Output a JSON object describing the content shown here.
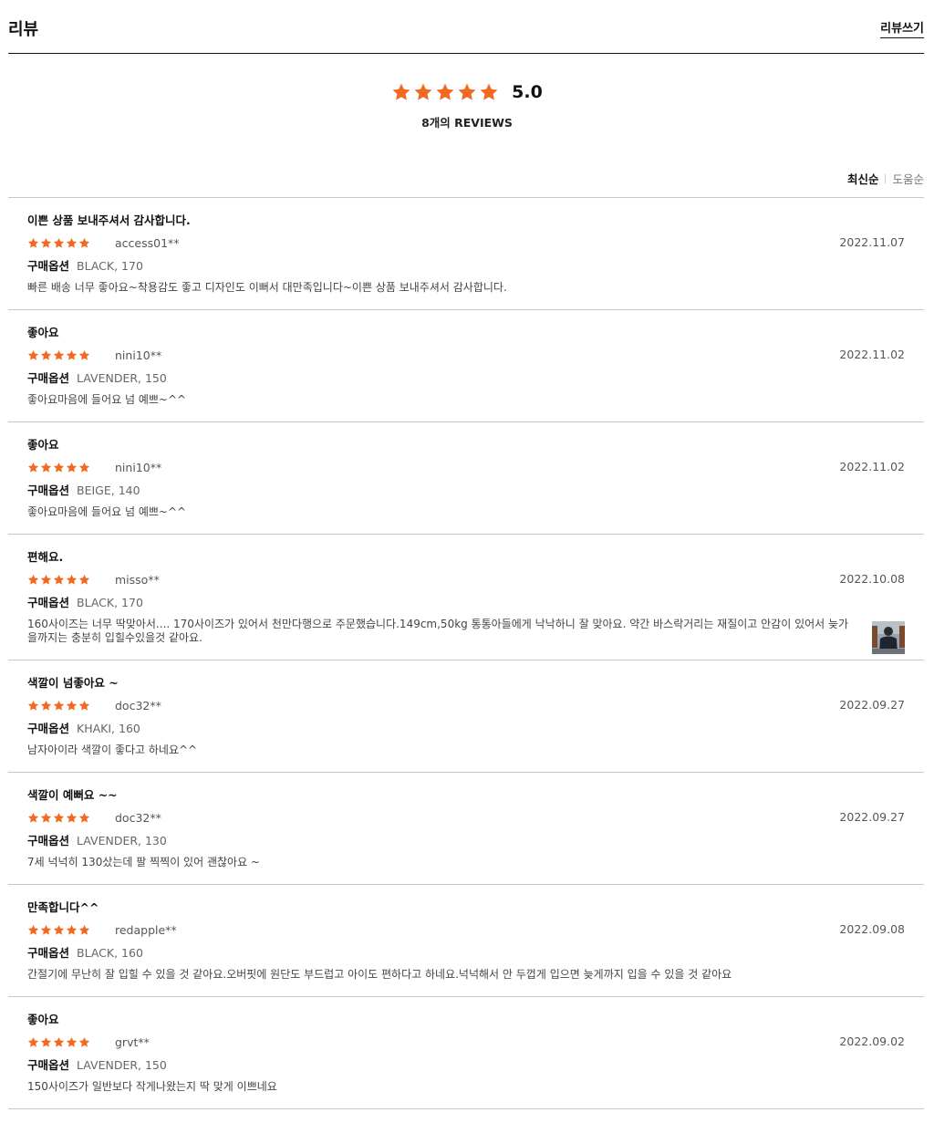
{
  "header": {
    "title": "리뷰",
    "write_label": "리뷰쓰기"
  },
  "summary": {
    "rating": 5,
    "score": "5.0",
    "count_label": "8개의 REVIEWS"
  },
  "sort": {
    "active": "최신순",
    "inactive": "도움순"
  },
  "colors": {
    "star": "#f26a21",
    "divider": "#c8c8c8"
  },
  "option_label": "구매옵션",
  "reviews": [
    {
      "title": "이쁜 상품 보내주셔서 감사합니다.",
      "rating": 5,
      "user": "access01**",
      "date": "2022.11.07",
      "option": "BLACK, 170",
      "body": "빠른 배송 너무 좋아요~착용감도 좋고 디자인도 이뻐서 대만족입니다~이쁜 상품 보내주셔서 감사합니다."
    },
    {
      "title": "좋아요",
      "rating": 5,
      "user": "nini10**",
      "date": "2022.11.02",
      "option": "LAVENDER, 150",
      "body": "좋아요마음에 들어요 넘 예쁘~^^"
    },
    {
      "title": "좋아요",
      "rating": 5,
      "user": "nini10**",
      "date": "2022.11.02",
      "option": "BEIGE, 140",
      "body": "좋아요마음에 들어요 넘 예쁘~^^"
    },
    {
      "title": "편해요.",
      "rating": 5,
      "user": "misso**",
      "date": "2022.10.08",
      "option": "BLACK, 170",
      "body": "160사이즈는 너무 딱맞아서.... 170사이즈가 있어서 천만다행으로 주문했습니다.149cm,50kg 통통아들에게 낙낙하니 잘 맞아요. 약간 바스락거리는 재질이고 안감이 있어서 늦가을까지는 충분히 입힐수있을것 같아요.",
      "has_photo": true
    },
    {
      "title": "색깔이 넘좋아요 ~",
      "rating": 5,
      "user": "doc32**",
      "date": "2022.09.27",
      "option": "KHAKI, 160",
      "body": "남자아이라 색깔이 좋다고 하네요^^"
    },
    {
      "title": "색깔이 예뻐요 ~~",
      "rating": 5,
      "user": "doc32**",
      "date": "2022.09.27",
      "option": "LAVENDER, 130",
      "body": "7세 넉넉히 130샀는데  팔 찍찍이 있어 괜찮아요 ~"
    },
    {
      "title": "만족합니다^^",
      "rating": 5,
      "user": "redapple**",
      "date": "2022.09.08",
      "option": "BLACK, 160",
      "body": "간절기에 무난히 잘 입힐 수 있을 것 같아요.오버핏에 원단도 부드럽고 아이도 편하다고 하네요.넉넉해서 안 두껍게 입으면 늦게까지 입을 수 있을 것 같아요"
    },
    {
      "title": "좋아요",
      "rating": 5,
      "user": "grvt**",
      "date": "2022.09.02",
      "option": "LAVENDER, 150",
      "body": "150사이즈가 일반보다 작게나왔는지 딱 맞게 이쁘네요"
    }
  ]
}
